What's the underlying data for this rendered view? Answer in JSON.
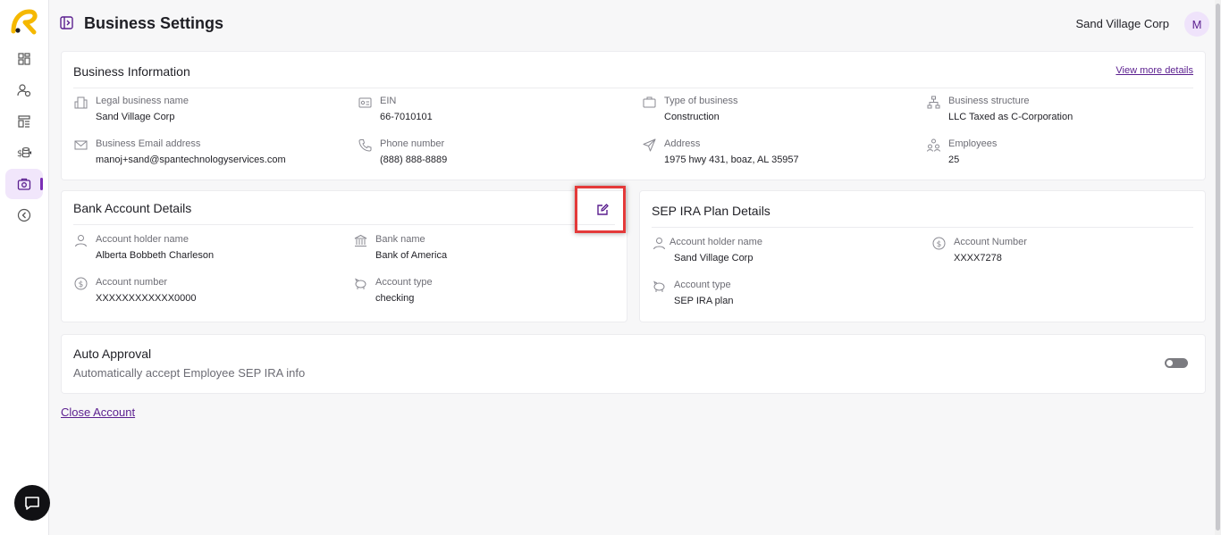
{
  "header": {
    "title": "Business Settings",
    "company": "Sand Village Corp",
    "avatar_initial": "M"
  },
  "sidebar": {
    "items": [
      {
        "icon": "dashboard-icon"
      },
      {
        "icon": "users-icon"
      },
      {
        "icon": "reports-icon"
      },
      {
        "icon": "finance-icon"
      },
      {
        "icon": "business-settings-icon",
        "active": true
      },
      {
        "icon": "collapse-left-icon"
      }
    ],
    "accent": "#7b2fb5"
  },
  "business_info": {
    "title": "Business Information",
    "view_more": "View more details",
    "fields": [
      {
        "label": "Legal business name",
        "value": "Sand Village Corp",
        "icon": "building-icon"
      },
      {
        "label": "EIN",
        "value": "66-7010101",
        "icon": "id-card-icon"
      },
      {
        "label": "Type of business",
        "value": "Construction",
        "icon": "briefcase-icon"
      },
      {
        "label": "Business structure",
        "value": "LLC Taxed as C-Corporation",
        "icon": "org-chart-icon"
      },
      {
        "label": "Business Email address",
        "value": "manoj+sand@spantechnologyservices.com",
        "icon": "mail-icon"
      },
      {
        "label": "Phone number",
        "value": "(888) 888-8889",
        "icon": "phone-icon"
      },
      {
        "label": "Address",
        "value": "1975 hwy 431, boaz, AL 35957",
        "icon": "send-icon"
      },
      {
        "label": "Employees",
        "value": "25",
        "icon": "people-icon"
      }
    ]
  },
  "bank_account": {
    "title": "Bank Account Details",
    "fields": [
      {
        "label": "Account holder name",
        "value": "Alberta Bobbeth Charleson",
        "icon": "person-icon"
      },
      {
        "label": "Bank name",
        "value": "Bank of America",
        "icon": "bank-icon"
      },
      {
        "label": "Account number",
        "value": "XXXXXXXXXXXX0000",
        "icon": "dollar-icon"
      },
      {
        "label": "Account type",
        "value": "checking",
        "icon": "piggy-bank-icon"
      }
    ]
  },
  "sep_ira": {
    "title": "SEP IRA Plan Details",
    "fields": [
      {
        "label": "Account holder name",
        "value": "Sand Village Corp",
        "icon": "person-icon"
      },
      {
        "label": "Account Number",
        "value": "XXXX7278",
        "icon": "dollar-icon"
      },
      {
        "label": "Account type",
        "value": "SEP IRA plan",
        "icon": "piggy-bank-icon"
      }
    ]
  },
  "auto_approval": {
    "title": "Auto Approval",
    "description": "Automatically accept Employee SEP IRA info",
    "enabled": false
  },
  "close_account": "Close Account"
}
